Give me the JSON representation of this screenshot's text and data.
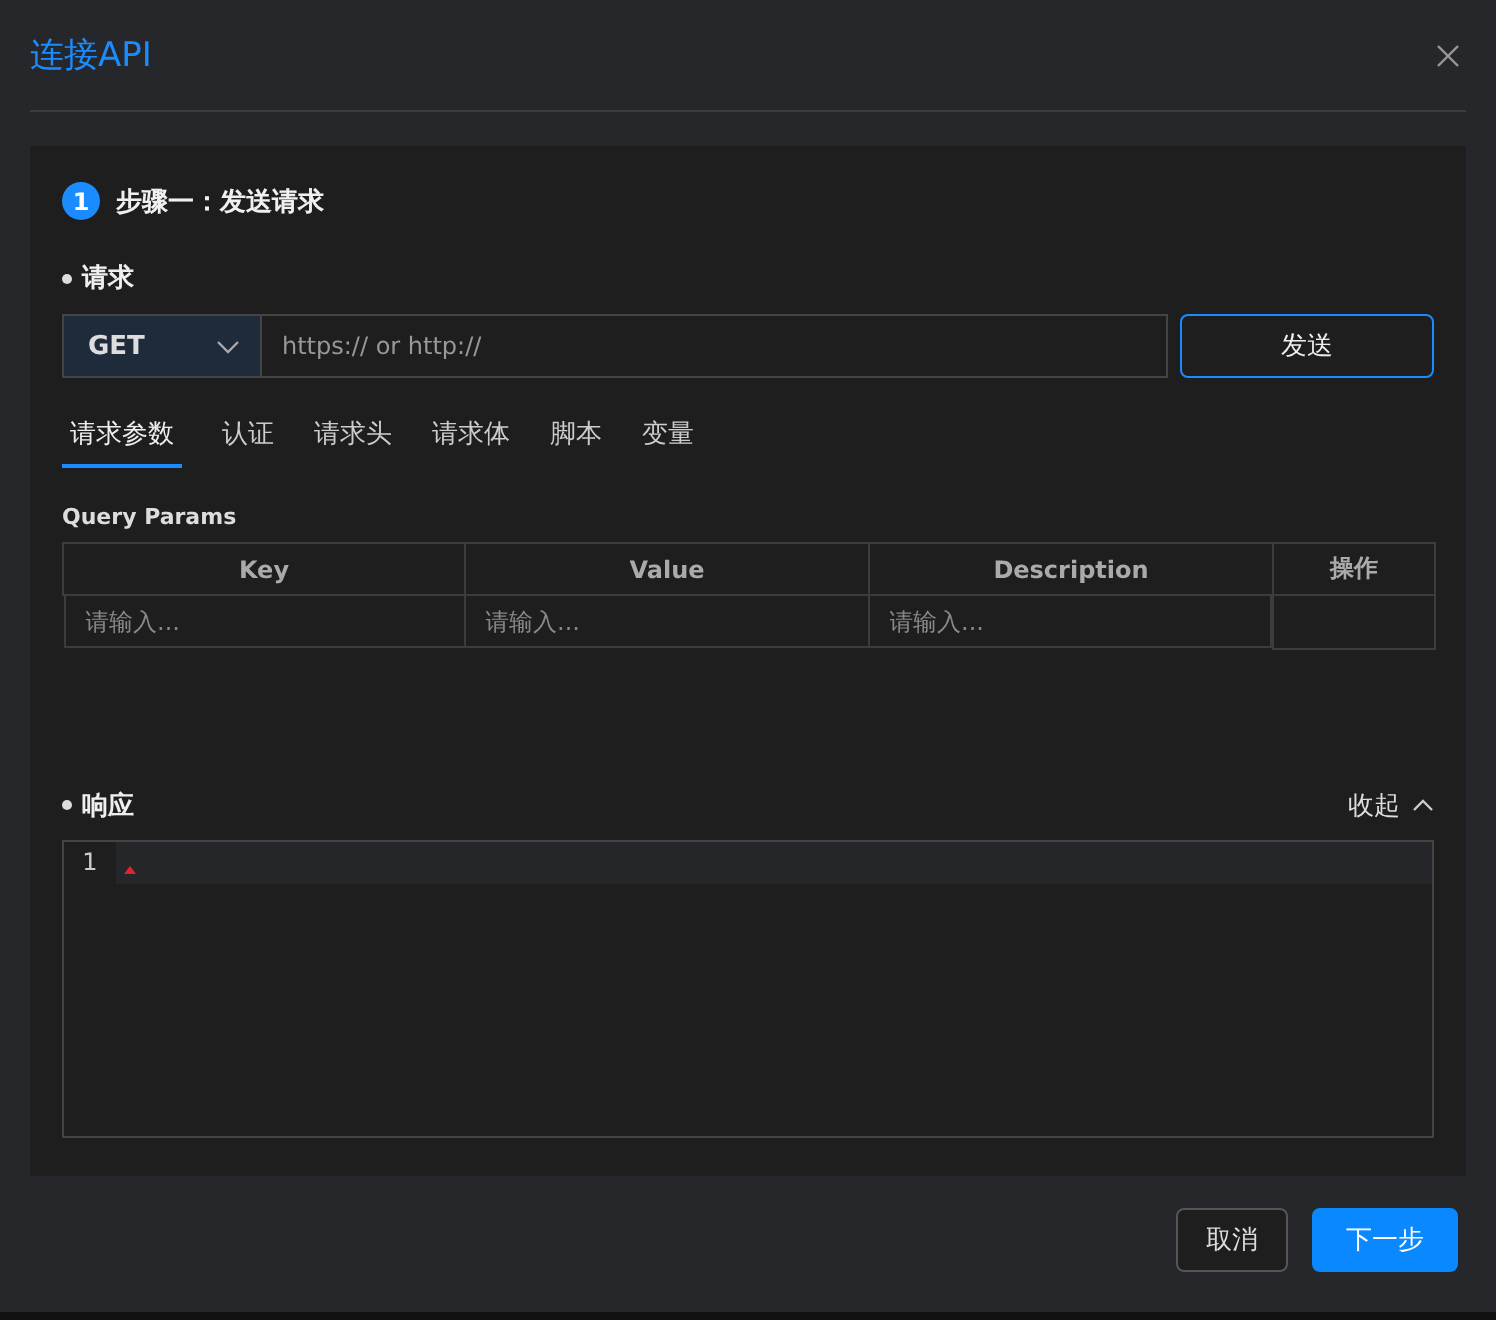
{
  "dialog": {
    "title": "连接API"
  },
  "step": {
    "number": "1",
    "title": "步骤一：发送请求"
  },
  "request": {
    "label": "请求",
    "method": "GET",
    "url_placeholder": "https:// or http://",
    "send": "发送"
  },
  "tabs": [
    {
      "label": "请求参数",
      "selected": true
    },
    {
      "label": "认证",
      "selected": false
    },
    {
      "label": "请求头",
      "selected": false
    },
    {
      "label": "请求体",
      "selected": false
    },
    {
      "label": "脚本",
      "selected": false
    },
    {
      "label": "变量",
      "selected": false
    }
  ],
  "params": {
    "title": "Query Params",
    "columns": [
      "Key",
      "Value",
      "Description",
      "操作"
    ],
    "rows": [
      {
        "key_placeholder": "请输入...",
        "value_placeholder": "请输入...",
        "description_placeholder": "请输入..."
      }
    ]
  },
  "response": {
    "label": "响应",
    "collapse": "收起",
    "line_numbers": [
      "1"
    ]
  },
  "buttons": [
    {
      "label": "取消",
      "kind": "secondary"
    },
    {
      "label": "下一步",
      "kind": "primary"
    }
  ]
}
